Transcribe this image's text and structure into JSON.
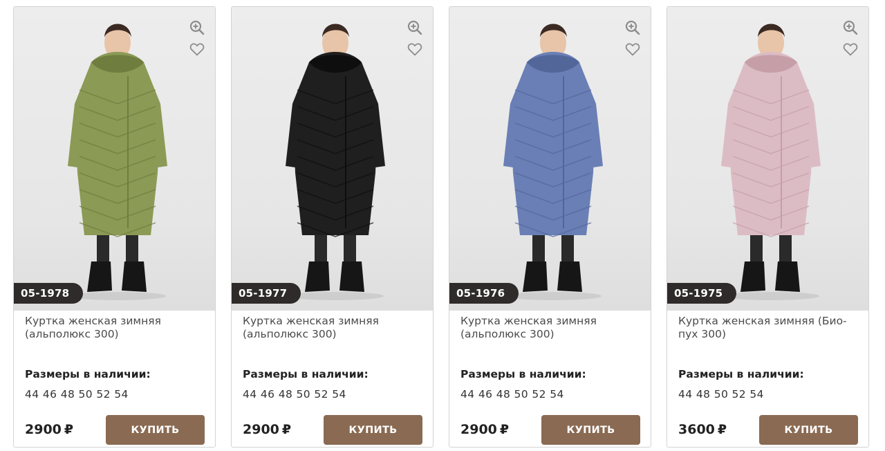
{
  "products": [
    {
      "sku": "05-1978",
      "title": "Куртка женская зимняя (альполюкс 300)",
      "sizes_label": "Размеры в наличии:",
      "sizes": "44 46 48 50 52 54",
      "price": "2900",
      "currency": "₽",
      "buy_label": "КУПИТЬ",
      "coat_color": "#8b9a55",
      "coat_shade": "#6f7d3f",
      "photo_alt": "olive quilted long coat"
    },
    {
      "sku": "05-1977",
      "title": "Куртка женская зимняя (альполюкс 300)",
      "sizes_label": "Размеры в наличии:",
      "sizes": "44 46 48 50 52 54",
      "price": "2900",
      "currency": "₽",
      "buy_label": "КУПИТЬ",
      "coat_color": "#1f1f1f",
      "coat_shade": "#0e0e0e",
      "photo_alt": "black quilted long coat"
    },
    {
      "sku": "05-1976",
      "title": "Куртка женская зимняя (альполюкс 300)",
      "sizes_label": "Размеры в наличии:",
      "sizes": "44 46 48 50 52 54",
      "price": "2900",
      "currency": "₽",
      "buy_label": "КУПИТЬ",
      "coat_color": "#6a7fb5",
      "coat_shade": "#52669a",
      "photo_alt": "blue quilted long coat"
    },
    {
      "sku": "05-1975",
      "title": "Куртка женская зимняя (Био-пух 300)",
      "sizes_label": "Размеры в наличии:",
      "sizes": "44 48 50 52 54",
      "price": "3600",
      "currency": "₽",
      "buy_label": "КУПИТЬ",
      "coat_color": "#dcbcc4",
      "coat_shade": "#c59ea8",
      "photo_alt": "pink quilted long coat with belt"
    }
  ],
  "icons": {
    "zoom": "zoom-in-icon",
    "favorite": "heart-icon"
  }
}
